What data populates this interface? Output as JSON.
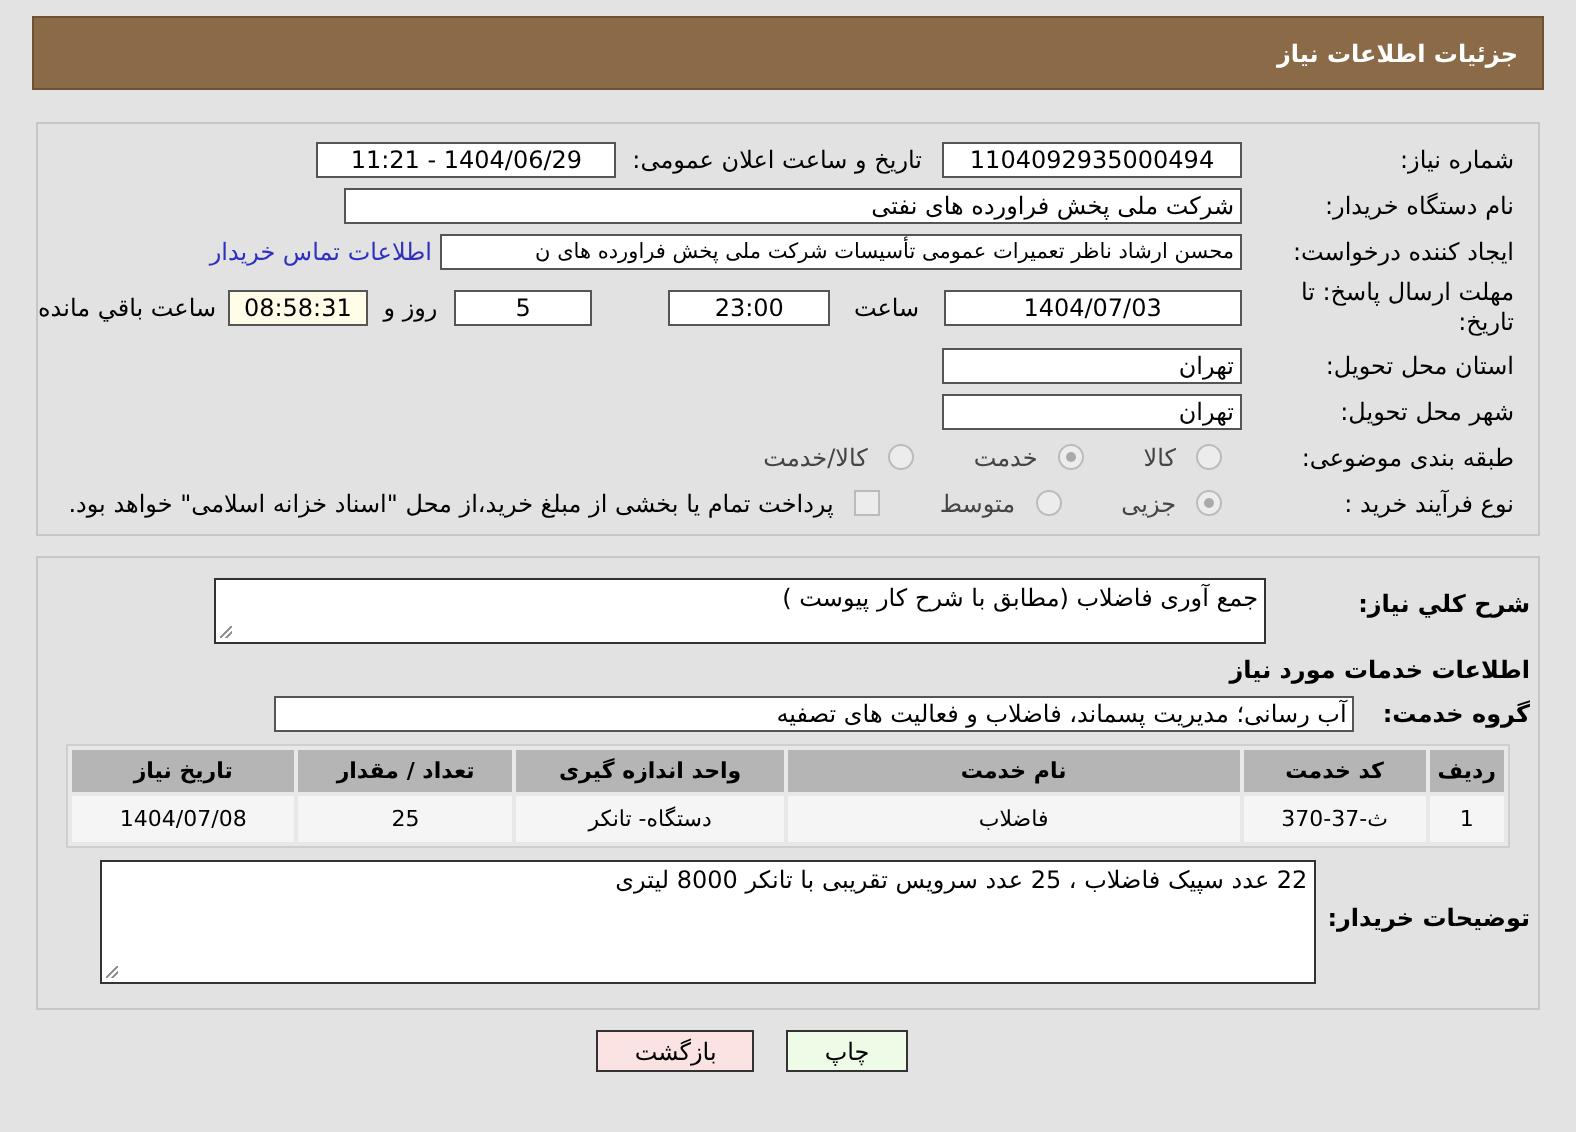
{
  "header": {
    "title": "جزئیات اطلاعات نیاز"
  },
  "details": {
    "need_number": {
      "label": "شماره نیاز:",
      "value": "1104092935000494"
    },
    "announce": {
      "label": "تاریخ و ساعت اعلان عمومی:",
      "value": "1404/06/29 - 11:21"
    },
    "buyer": {
      "label": "نام دستگاه خریدار:",
      "value": "شرکت ملی پخش فراورده های نفتی"
    },
    "creator": {
      "label": "ایجاد کننده درخواست:",
      "value": "محسن ارشاد ناظر تعمیرات عمومی تأسیسات شرکت ملی پخش فراورده های ن",
      "link": "اطلاعات تماس خریدار"
    },
    "deadline": {
      "label": "مهلت ارسال پاسخ: تا تاریخ:",
      "date": "1404/07/03",
      "time_label": "ساعت",
      "time": "23:00",
      "days": "5",
      "days_label": "روز و",
      "remaining": "08:58:31",
      "remaining_label": "ساعت باقي مانده"
    },
    "province": {
      "label": "استان محل تحویل:",
      "value": "تهران"
    },
    "city": {
      "label": "شهر محل تحویل:",
      "value": "تهران"
    },
    "category": {
      "label": "طبقه بندی موضوعی:",
      "options": [
        {
          "label": "کالا",
          "selected": false
        },
        {
          "label": "خدمت",
          "selected": true
        },
        {
          "label": "کالا/خدمت",
          "selected": false
        }
      ]
    },
    "process": {
      "label": "نوع فرآیند خرید :",
      "options": [
        {
          "label": "جزیی",
          "selected": true
        },
        {
          "label": "متوسط",
          "selected": false
        }
      ],
      "treasury": {
        "label": "پرداخت تمام یا بخشی از مبلغ خرید،از محل \"اسناد خزانه اسلامی\" خواهد بود.",
        "checked": false
      }
    }
  },
  "services": {
    "description": {
      "label": "شرح کلي نياز:",
      "value": "جمع آوری فاضلاب (مطابق با شرح کار پیوست )"
    },
    "section_title": "اطلاعات خدمات مورد نیاز",
    "group": {
      "label": "گروه خدمت:",
      "value": "آب رسانی؛ مدیریت پسماند، فاضلاب و فعالیت های تصفیه"
    },
    "table": {
      "columns": [
        "ردیف",
        "کد خدمت",
        "نام خدمت",
        "واحد اندازه گیری",
        "تعداد / مقدار",
        "تاریخ نیاز"
      ],
      "rows": [
        [
          "1",
          "ث-37-370",
          "فاضلاب",
          "دستگاه- تانکر",
          "25",
          "1404/07/08"
        ]
      ]
    },
    "notes": {
      "label": "توضیحات خریدار:",
      "value": "22 عدد سپیک فاضلاب ، 25 عدد سرویس تقریبی با تانکر 8000 لیتری"
    }
  },
  "buttons": [
    {
      "label": "چاپ",
      "kind": "print"
    },
    {
      "label": "بازگشت",
      "kind": "back"
    }
  ]
}
